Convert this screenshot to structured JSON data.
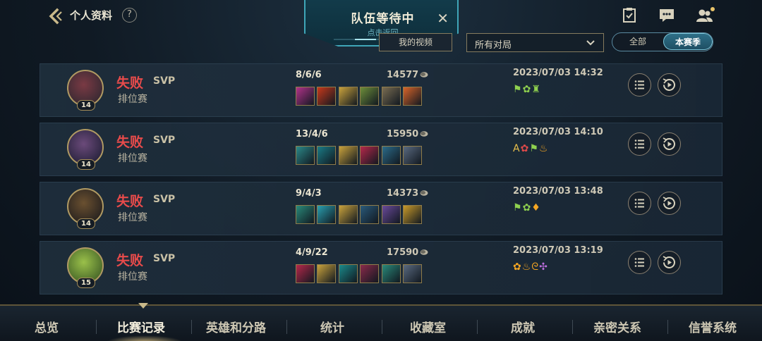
{
  "header": {
    "title": "个人资料",
    "help": "?",
    "icons": [
      "mission-icon",
      "chat-icon",
      "friends-icon"
    ]
  },
  "queue": {
    "title": "队伍等待中",
    "subtitle": "点击返回",
    "close": "✕"
  },
  "toolbar": {
    "video_button": "我的视频",
    "filter_value": "所有对局",
    "season_options": [
      "全部",
      "本赛季"
    ],
    "season_selected": "本赛季"
  },
  "matches": [
    {
      "level": "14",
      "result": "失败",
      "badge": "SVP",
      "mode": "排位赛",
      "kda": "8/6/6",
      "gold": "14577",
      "date": "2023/07/03 14:32",
      "avatar_colors": [
        "#3a2a33",
        "#7a3a44"
      ],
      "items": [
        "#b1338a",
        "#c7391b",
        "#c9a23c",
        "#6d8e3a",
        "#7a6d52",
        "#d8642a"
      ],
      "achievements": [
        {
          "glyph": "⚑",
          "tone": "g"
        },
        {
          "glyph": "✿",
          "tone": "g"
        },
        {
          "glyph": "♜",
          "tone": "g"
        }
      ]
    },
    {
      "level": "14",
      "result": "失败",
      "badge": "SVP",
      "mode": "排位赛",
      "kda": "13/4/6",
      "gold": "15950",
      "date": "2023/07/03 14:10",
      "avatar_colors": [
        "#2b2540",
        "#6b4a7a"
      ],
      "items": [
        "#2c8a8a",
        "#1b7c86",
        "#c9a23c",
        "#b5284a",
        "#2c6c8a",
        "#5a6a80"
      ],
      "achievements": [
        {
          "glyph": "A",
          "tone": "y"
        },
        {
          "glyph": "✿",
          "tone": "r"
        },
        {
          "glyph": "⚑",
          "tone": "g"
        },
        {
          "glyph": "♨",
          "tone": "o"
        }
      ]
    },
    {
      "level": "14",
      "result": "失败",
      "badge": "SVP",
      "mode": "排位赛",
      "kda": "9/4/3",
      "gold": "14373",
      "date": "2023/07/03 13:48",
      "avatar_colors": [
        "#2a2420",
        "#6a5030"
      ],
      "items": [
        "#2a8a7a",
        "#2aa0b0",
        "#c9a23c",
        "#2a5a7a",
        "#6a4a9a",
        "#c89a2a"
      ],
      "achievements": [
        {
          "glyph": "⚑",
          "tone": "g"
        },
        {
          "glyph": "✿",
          "tone": "g"
        },
        {
          "glyph": "♦",
          "tone": "o"
        }
      ]
    },
    {
      "level": "15",
      "result": "失败",
      "badge": "SVP",
      "mode": "排位赛",
      "kda": "4/9/22",
      "gold": "17590",
      "date": "2023/07/03 13:19",
      "avatar_colors": [
        "#4a6a2a",
        "#9ac04a"
      ],
      "items": [
        "#b5284a",
        "#c9a23c",
        "#1b8a8a",
        "#8a2a4a",
        "#2a8a7a",
        "#5a6a80"
      ],
      "achievements": [
        {
          "glyph": "✿",
          "tone": "o"
        },
        {
          "glyph": "♨",
          "tone": "o"
        },
        {
          "glyph": "ᘓ",
          "tone": "o"
        },
        {
          "glyph": "✣",
          "tone": "p"
        }
      ]
    }
  ],
  "tabs": [
    "总览",
    "比赛记录",
    "英雄和分路",
    "统计",
    "收藏室",
    "成就",
    "亲密关系",
    "信誉系统"
  ],
  "active_tab": "比赛记录",
  "colors": {
    "loss": "#e84b4b",
    "accent": "#3fa6b8",
    "gold_border": "#b09a63"
  }
}
